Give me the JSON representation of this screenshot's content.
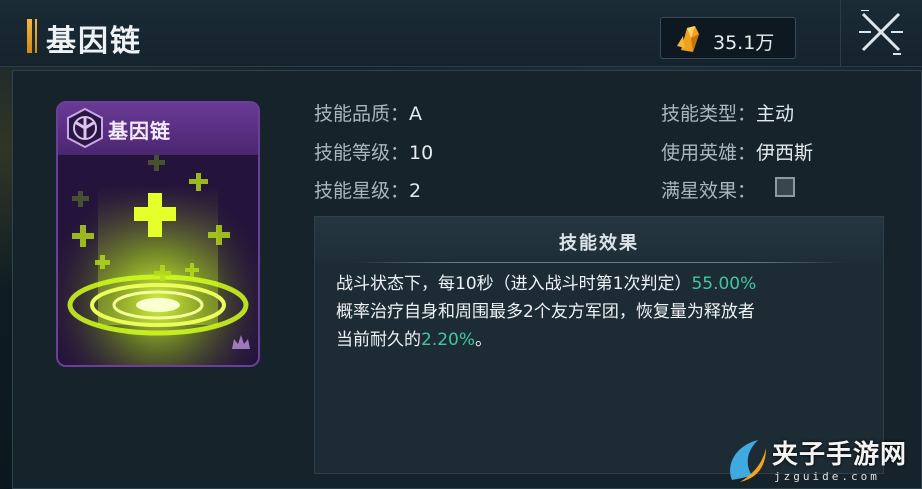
{
  "header": {
    "title": "基因链",
    "currency_icon": "gold-crystal-icon",
    "currency_value": "35.1万",
    "close_icon": "close-icon"
  },
  "card": {
    "name": "基因链",
    "emblem_icon": "hexagon-emblem-icon",
    "art_icon": "healing-cross-ring-icon",
    "rank_icon": "crown-rank-icon",
    "frame_color": "#6e3f9a",
    "glow_color": "#c8ff1a"
  },
  "stats": {
    "quality_label": "技能品质：",
    "quality_value": "A",
    "level_label": "技能等级：",
    "level_value": "10",
    "star_label": "技能星级：",
    "star_value": "2",
    "type_label": "技能类型：",
    "type_value": "主动",
    "hero_label": "使用英雄：",
    "hero_value": "伊西斯",
    "maxstar_label": "满星效果："
  },
  "effect": {
    "title": "技能效果",
    "line1_a": "战斗状态下，每10秒（进入战斗时第1次判定）",
    "line1_pct": "55.00%",
    "line2": "概率治疗自身和周围最多2个友方军团，恢复量为释放者",
    "line3_a": "当前耐久的",
    "line3_pct": "2.20%",
    "line3_b": "。",
    "highlight_color": "#41c7a0"
  },
  "watermark": {
    "name": "夹子手游网",
    "url": "jzguide.com"
  }
}
